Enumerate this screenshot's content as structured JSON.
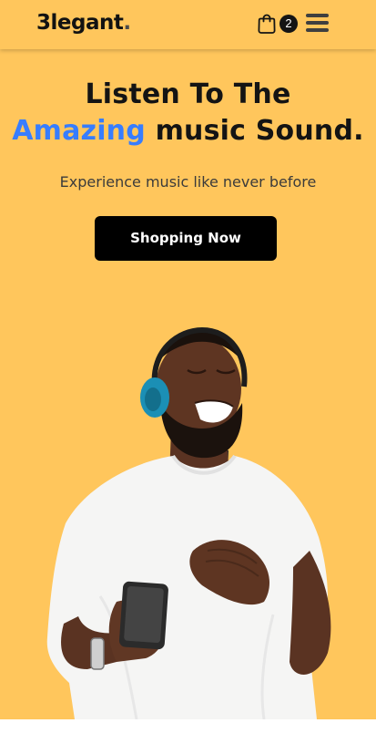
{
  "header": {
    "logo_text": "3legant",
    "logo_dot": ".",
    "cart_count": "2"
  },
  "hero": {
    "headline_line1": "Listen To The",
    "headline_accent": "Amazing",
    "headline_rest": " music Sound.",
    "subtitle": "Experience music like never before",
    "cta_label": "Shopping Now",
    "accent_color": "#377DFF",
    "background_color": "#FFC65C"
  },
  "icons": {
    "cart": "shopping-bag-icon",
    "menu": "hamburger-menu-icon"
  }
}
